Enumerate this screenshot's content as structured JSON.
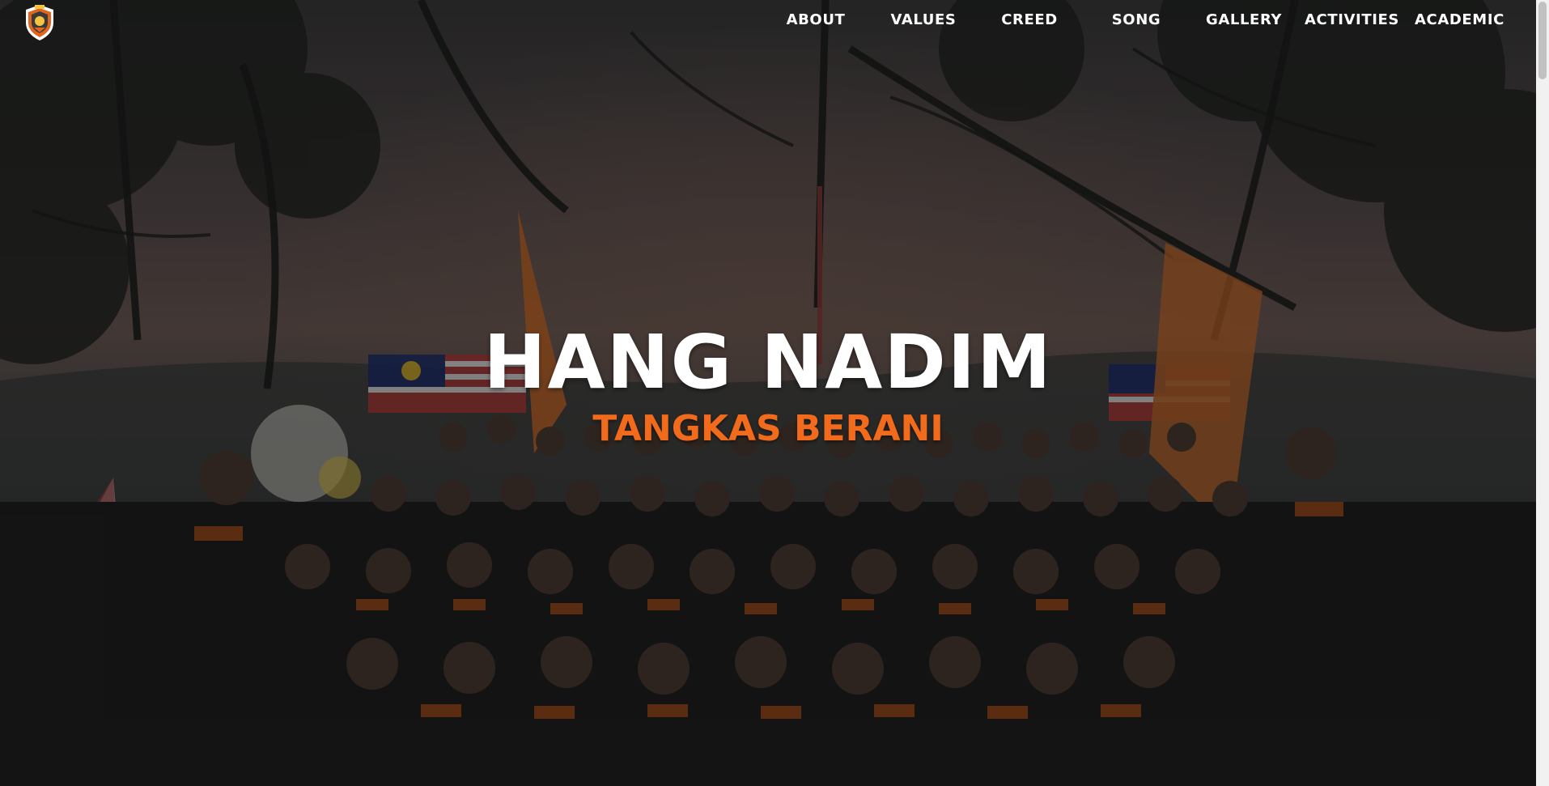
{
  "nav": {
    "items": [
      {
        "label": "ABOUT"
      },
      {
        "label": "VALUES"
      },
      {
        "label": "CREED"
      },
      {
        "label": "SONG"
      },
      {
        "label": "GALLERY"
      },
      {
        "label": "ACTIVITIES"
      },
      {
        "label": "ACADEMIC"
      }
    ],
    "logo_icon": "shield-crest-icon"
  },
  "hero": {
    "title": "HANG NADIM",
    "tagline": "TANGKAS BERANI"
  },
  "colors": {
    "accent": "#f26b1d",
    "text": "#ffffff",
    "overlay": "#000000"
  }
}
